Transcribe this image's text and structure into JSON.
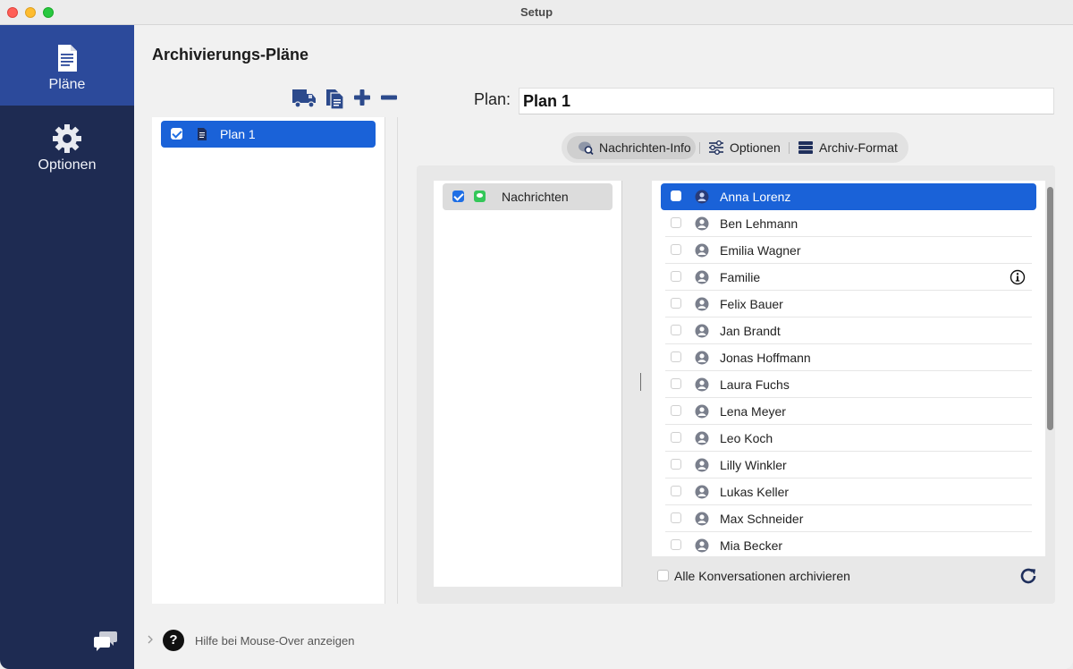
{
  "window": {
    "title": "Setup"
  },
  "sidebar": {
    "items": [
      {
        "label": "Pläne",
        "icon": "document-icon",
        "active": true
      },
      {
        "label": "Optionen",
        "icon": "gear-icon",
        "active": false
      }
    ],
    "footer_icon": "chat-bubbles-icon"
  },
  "header": {
    "title": "Archivierungs-Pläne"
  },
  "toolbar": {
    "buttons": [
      "truck-icon",
      "duplicate-icon",
      "plus-icon",
      "minus-icon"
    ]
  },
  "plans": {
    "items": [
      {
        "label": "Plan 1",
        "checked": true,
        "selected": true
      }
    ]
  },
  "plan_editor": {
    "name_label": "Plan:",
    "name_value": "Plan 1"
  },
  "tabs": [
    {
      "label": "Nachrichten-Info",
      "icon": "message-search-icon",
      "active": true
    },
    {
      "label": "Optionen",
      "icon": "sliders-icon",
      "active": false
    },
    {
      "label": "Archiv-Format",
      "icon": "stack-icon",
      "active": false
    }
  ],
  "sources": {
    "items": [
      {
        "label": "Nachrichten",
        "checked": true
      }
    ]
  },
  "contacts": {
    "items": [
      {
        "name": "Anna Lorenz",
        "selected": true,
        "checked": false
      },
      {
        "name": "Ben Lehmann",
        "selected": false,
        "checked": false
      },
      {
        "name": "Emilia Wagner",
        "selected": false,
        "checked": false
      },
      {
        "name": "Familie",
        "selected": false,
        "checked": false,
        "info": true
      },
      {
        "name": "Felix Bauer",
        "selected": false,
        "checked": false
      },
      {
        "name": "Jan Brandt",
        "selected": false,
        "checked": false
      },
      {
        "name": "Jonas Hoffmann",
        "selected": false,
        "checked": false
      },
      {
        "name": "Laura Fuchs",
        "selected": false,
        "checked": false
      },
      {
        "name": "Lena Meyer",
        "selected": false,
        "checked": false
      },
      {
        "name": "Leo Koch",
        "selected": false,
        "checked": false
      },
      {
        "name": "Lilly Winkler",
        "selected": false,
        "checked": false
      },
      {
        "name": "Lukas Keller",
        "selected": false,
        "checked": false
      },
      {
        "name": "Max Schneider",
        "selected": false,
        "checked": false
      },
      {
        "name": "Mia Becker",
        "selected": false,
        "checked": false
      }
    ],
    "archive_all_label": "Alle Konversationen archivieren",
    "archive_all_checked": false
  },
  "help": {
    "label": "Hilfe bei Mouse-Over anzeigen"
  },
  "colors": {
    "sidebar_bg": "#1e2b52",
    "sidebar_active": "#2c4a9b",
    "selection": "#1a62d8",
    "accent_icon": "#2c4a8c"
  }
}
